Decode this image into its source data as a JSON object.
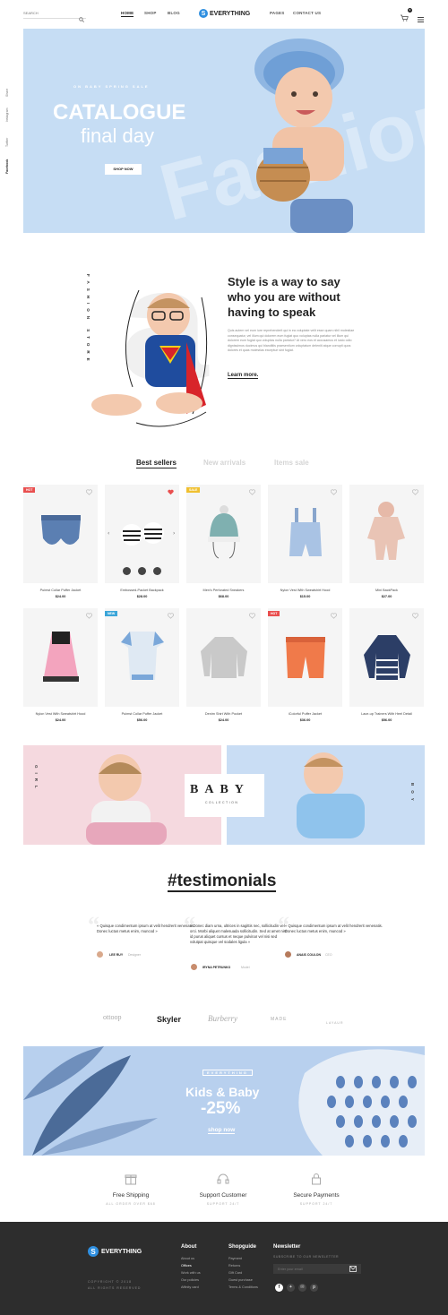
{
  "colors": {
    "hero_bg": "#c6ddf4",
    "accent_red": "#e94f4f",
    "accent_blue": "#3b7fd8",
    "footer_bg": "#2d2d2d",
    "card_bg": "#f5f5f5"
  },
  "header": {
    "search_placeholder": "SEARCH",
    "nav": [
      "HOME",
      "SHOP",
      "BLOG",
      "PAGES",
      "CONTACT US"
    ],
    "logo": "EVERYTHING",
    "logo_mark": "S",
    "cart_count": "0"
  },
  "social_side": [
    "Share",
    "Instagram",
    "Twitter",
    "Facebook"
  ],
  "hero": {
    "kicker": "ON BABY SPRING SALE",
    "title": "CATALOGUE",
    "subtitle": "final day",
    "button": "SHOP NOW",
    "watermark": "Fashion"
  },
  "about": {
    "vertical_text": "FASHION STORE",
    "heading_line1": "Style is a way to say",
    "heading_line2": "who you are without",
    "heading_line3": "having to speak",
    "body": "Quis autem vel eum iure reprehenderit qui in ea voluptate velit esse quam nihil molestiae consequatur, vel illum qui dolorem eum fugiat quo voluptas nulla pariatur vel illum qui dolorem eum fugiat quo voluptas nulla pariatur? At vero eos et accusamus et iusto odio dignissimos ducimus qui blanditiis praesentium voluptatum deleniti atque corrupti quos dolores et quas molestias excepturi sint fugiat.",
    "link": "Learn more."
  },
  "tabs": [
    "Best sellers",
    "New arrivals",
    "Items sale"
  ],
  "products": [
    {
      "name": "Puimst Collar Puffer Jacket",
      "price": "$24.00",
      "badge": "HOT",
      "badge_color": "#e94f4f"
    },
    {
      "name": "Embossed-Packet Backpack",
      "price": "$28.00",
      "badge": "",
      "badge_color": ""
    },
    {
      "name": "Men's Perforated Sneakers",
      "price": "$68.00",
      "badge": "SALE",
      "badge_color": "#f0c030"
    },
    {
      "name": "Nylon Vest With Sweatshirt Hood",
      "price": "$15.00",
      "badge": "",
      "badge_color": ""
    },
    {
      "name": "Mini BackPack",
      "price": "$27.00",
      "badge": "",
      "badge_color": ""
    },
    {
      "name": "Nylon Vest With Sweatshirt Hood",
      "price": "$24.00",
      "badge": "",
      "badge_color": ""
    },
    {
      "name": "Puimst Collar Puffer Jacket",
      "price": "$56.00",
      "badge": "NEW",
      "badge_color": "#3ba5d8"
    },
    {
      "name": "Denim Shirt With Pocket",
      "price": "$24.00",
      "badge": "",
      "badge_color": ""
    },
    {
      "name": "iColorful Puffer Jacket",
      "price": "$36.00",
      "badge": "HOT",
      "badge_color": "#e94f4f"
    },
    {
      "name": "Lace-up Trainers With Heel Detail",
      "price": "$56.00",
      "badge": "",
      "badge_color": ""
    }
  ],
  "banner": {
    "left_vertical": "GIRL",
    "right_vertical": "BOY",
    "title": "BABY",
    "subtitle": "COLLECTION"
  },
  "testimonials": {
    "heading": "#testimonials",
    "items": [
      {
        "text": "« Quisque condimentum ipsum at velit hendrerit venenatis. Donec luctus metus enim, muncod »",
        "author": "LEE RUY",
        "role": "Designer"
      },
      {
        "text": "« Donec diam urna, ultrices in sagittis nec, sollicitudin vel orci. Morbi aliquet malesuada sollicitudin. Sed at amet nisl id purus aliquet cursus et neque pulvinar vel nisi sed volutpat quisque vel sodales ligula »",
        "author": "IRYNA PETRUNKO",
        "role": "Model"
      },
      {
        "text": "« Quisque condimentum ipsum at velit hendrerit venenatis. Donec luctus metus enim, muncod »",
        "author": "ANAIS COULON",
        "role": "CEO"
      }
    ]
  },
  "brands": [
    "ottoop",
    "Skyler",
    "Burberry",
    "MADE",
    "LAYAUR"
  ],
  "promo": {
    "kicker": "EVERYTHING",
    "title": "Kids & Baby",
    "discount": "-25%",
    "link": "shop now"
  },
  "features": [
    {
      "title": "Free Shipping",
      "sub": "ALL ORDER OVER $68"
    },
    {
      "title": "Support Customer",
      "sub": "SUPPORT 24/7"
    },
    {
      "title": "Secure Payments",
      "sub": "SUPPORT 24/7"
    }
  ],
  "footer": {
    "logo": "EVERYTHING",
    "copyright": "COPYRIGHT © 2018",
    "rights": "ALL RIGHTS RESERVED",
    "about_head": "About",
    "about_links": [
      "About us",
      "Offices",
      "Work with us",
      "Our policies",
      "Affinity card"
    ],
    "shop_head": "Shopguide",
    "shop_links": [
      "Payment",
      "Returns",
      "Gift Card",
      "Guest purchase",
      "Terms & Conditions"
    ],
    "news_head": "Newsletter",
    "news_sub": "SUBSCRIBE TO OUR NEWSLETTER",
    "news_placeholder": "Enter your email"
  }
}
